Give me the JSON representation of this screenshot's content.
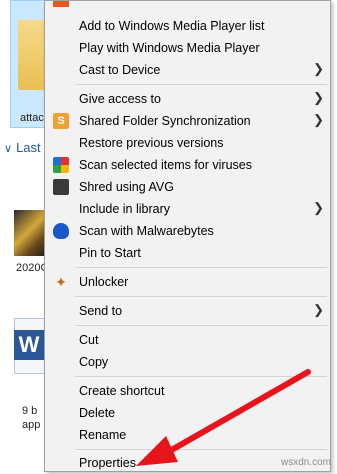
{
  "explorer": {
    "folder_label": "attac",
    "recent_group": "Last",
    "thumb_label": "2020C",
    "doc_badge": "W",
    "doc_label_line1": "9 b",
    "doc_label_line2": "app"
  },
  "menu": {
    "items": [
      {
        "label": "Add to Windows Media Player list"
      },
      {
        "label": "Play with Windows Media Player"
      },
      {
        "label": "Cast to Device"
      },
      {
        "label": "Give access to"
      },
      {
        "label": "Shared Folder Synchronization"
      },
      {
        "label": "Restore previous versions"
      },
      {
        "label": "Scan selected items for viruses"
      },
      {
        "label": "Shred using AVG"
      },
      {
        "label": "Include in library"
      },
      {
        "label": "Scan with Malwarebytes"
      },
      {
        "label": "Pin to Start"
      },
      {
        "label": "Unlocker"
      },
      {
        "label": "Send to"
      },
      {
        "label": "Cut"
      },
      {
        "label": "Copy"
      },
      {
        "label": "Create shortcut"
      },
      {
        "label": "Delete"
      },
      {
        "label": "Rename"
      },
      {
        "label": "Properties"
      }
    ],
    "shared_sync_icon": "S"
  },
  "icons": {
    "submenu": "chevron-right-icon",
    "annotation": "red-arrow"
  },
  "colors": {
    "annotation": "#e8141c",
    "menu_bg": "#f2f2f2",
    "selection": "#cce8ff"
  },
  "watermark": "wsxdn.com"
}
